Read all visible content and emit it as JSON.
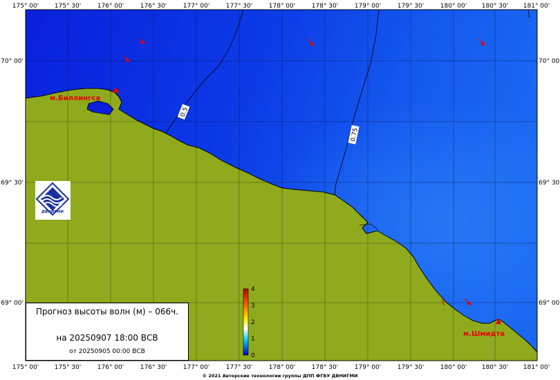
{
  "map": {
    "lon_labels": [
      "175° 00'",
      "175° 30'",
      "176° 00'",
      "176° 30'",
      "177° 00'",
      "177° 30'",
      "178° 00'",
      "178° 30'",
      "179° 00'",
      "179° 30'",
      "180° 00'",
      "180° 30'",
      "181° 00'"
    ],
    "lat_labels": [
      "70° 00'",
      "69° 30'",
      "69° 00'"
    ],
    "places": {
      "billings": "м.Биллингса",
      "schmidt": "м.Шмидта"
    },
    "contours": [
      "0.5",
      "0.75"
    ],
    "colors": {
      "land": "#8faa1d",
      "sea_deep": "#0a2be0",
      "sea_light": "#1a6af0",
      "place_label": "#e60000"
    }
  },
  "legend": {
    "ticks": [
      "4",
      "3",
      "2",
      "1",
      "0"
    ],
    "colors": [
      "#0000cc",
      "#00c8ff",
      "#ffffff",
      "#ffe600",
      "#ff6600",
      "#b30000"
    ]
  },
  "title": {
    "line1": "Прогноз высоты волн (м) – 066ч.",
    "line2": "на 20250907 18:00 ВСВ",
    "line3": "от 20250905 00:00 ВСВ"
  },
  "logo": {
    "caption": "ДВНИГМИ",
    "icon": "dvnigmi-logo-icon"
  },
  "footer": {
    "copyright": "© 2021 Авторские технологии группы ДПП ФГБУ ДВНИГМИ"
  }
}
